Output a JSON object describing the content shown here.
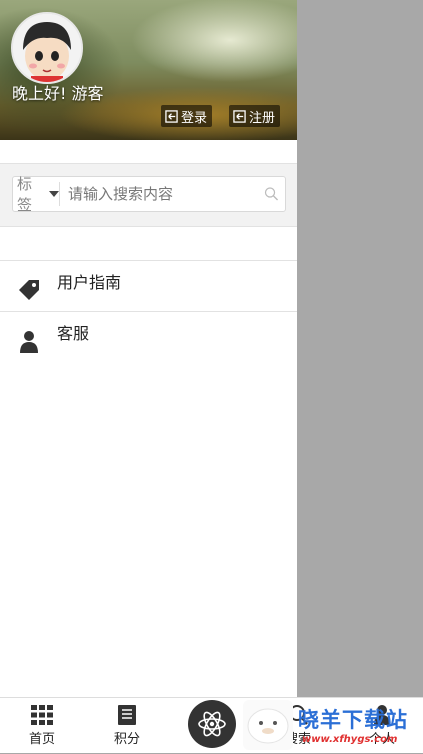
{
  "header": {
    "greeting": "晚上好! 游客",
    "login_label": "登录",
    "register_label": "注册"
  },
  "search": {
    "tag_label": "标签",
    "placeholder": "请输入搜索内容"
  },
  "menu": {
    "items": [
      {
        "label": "用户指南",
        "icon": "tag-icon"
      },
      {
        "label": "客服",
        "icon": "person-icon"
      }
    ]
  },
  "bottom_nav": {
    "items": [
      {
        "label": "首页",
        "icon": "grid-icon"
      },
      {
        "label": "积分",
        "icon": "document-icon"
      },
      {
        "label": "",
        "icon": "atom-icon"
      },
      {
        "label": "搜索",
        "icon": "search-icon"
      },
      {
        "label": "个人",
        "icon": "person-icon"
      }
    ]
  },
  "watermark": {
    "text": "晓羊下载站",
    "url": "www.xfhygs.com"
  },
  "colors": {
    "overlay": "#a8a8a8",
    "watermark_blue": "#2b6fd6",
    "watermark_red": "#e03030"
  }
}
